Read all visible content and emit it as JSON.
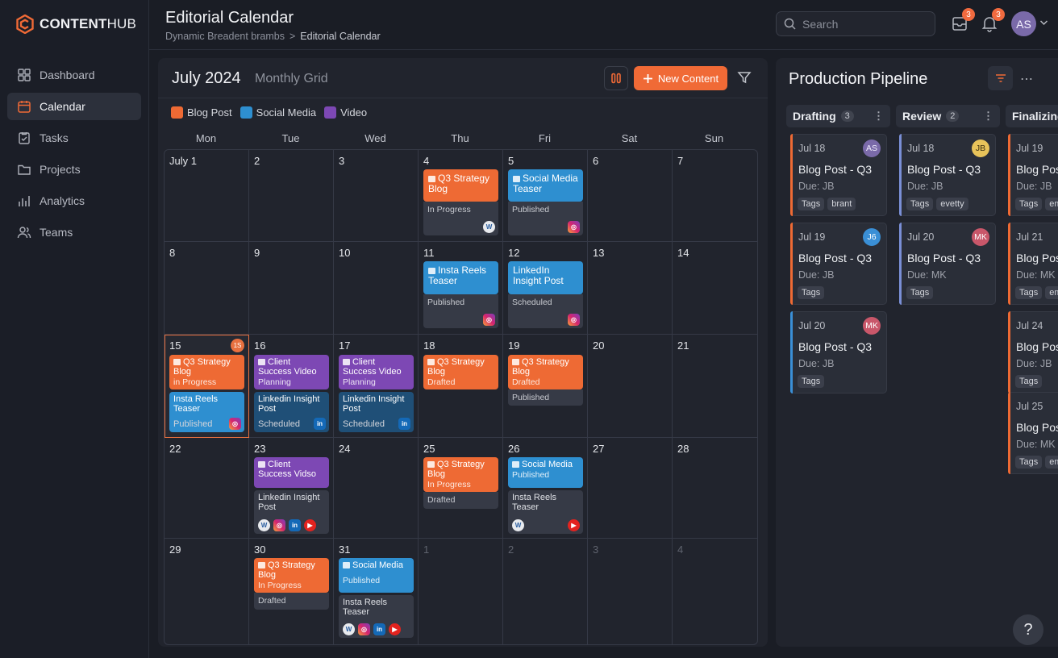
{
  "brand": {
    "bold": "CONTENT",
    "regular": "HUB",
    "accent": "#f06a36"
  },
  "sidebar": {
    "items": [
      {
        "label": "Dashboard",
        "icon": "dashboard-icon"
      },
      {
        "label": "Calendar",
        "icon": "calendar-icon",
        "active": true
      },
      {
        "label": "Tasks",
        "icon": "tasks-icon"
      },
      {
        "label": "Projects",
        "icon": "folder-icon"
      },
      {
        "label": "Analytics",
        "icon": "analytics-icon"
      },
      {
        "label": "Teams",
        "icon": "teams-icon"
      }
    ]
  },
  "header": {
    "title": "Editorial Calendar",
    "breadcrumb_parent": "Dynamic Breadent brambs",
    "breadcrumb_separator": ">",
    "breadcrumb_current": "Editorial Calendar",
    "search_placeholder": "Search",
    "inbox_badge": "3",
    "notif_badge": "3",
    "avatar": "AS"
  },
  "calendar": {
    "month": "July 2024",
    "view": "Monthly Grid",
    "new_button": "New Content",
    "legend": [
      {
        "label": "Blog Post",
        "color": "#ee6a34"
      },
      {
        "label": "Social Media",
        "color": "#2e8fd0"
      },
      {
        "label": "Video",
        "color": "#7d48b4"
      }
    ],
    "days": [
      "Mon",
      "Tue",
      "Wed",
      "Thu",
      "Fri",
      "Sat",
      "Sun"
    ],
    "weeks": [
      [
        "July 1",
        "2",
        "3",
        "4",
        "5",
        "6",
        "7"
      ],
      [
        "8",
        "9",
        "10",
        "11",
        "12",
        "13",
        "14"
      ],
      [
        "15",
        "16",
        "17",
        "18",
        "19",
        "20",
        "21"
      ],
      [
        "22",
        "23",
        "24",
        "25",
        "26",
        "27",
        "28"
      ],
      [
        "29",
        "30",
        "31",
        "1",
        "2",
        "3",
        "4"
      ]
    ],
    "today_badge": "1S",
    "events": {
      "jul4_title": "Q3 Strategy Blog",
      "jul4_status": "In Progress",
      "jul5_title": "Social Media Teaser",
      "jul5_status": "Published",
      "jul11_title": "Insta Reels Teaser",
      "jul11_status": "Published",
      "jul12_title": "LinkedIn Insight Post",
      "jul12_status": "Scheduled",
      "jul15a_title": "Q3 Strategy Blog",
      "jul15a_status": "in Progress",
      "jul15b_title": "Insta Reels Teaser",
      "jul15b_status": "Published",
      "jul16a_title": "Client Success Video",
      "jul16a_status": "Planning",
      "jul16b_title": "Linkedin Insight Post",
      "jul16b_status": "Scheduled",
      "jul17a_title": "Client Success Video",
      "jul17a_status": "Planning",
      "jul17b_title": "Linkedin Insight Post",
      "jul17b_status": "Scheduled",
      "jul18_title": "Q3 Strategy Blog",
      "jul18_status": "Drafted",
      "jul19_title": "Q3 Strategy Blog",
      "jul19_status": "Drafted",
      "jul19_status2": "Published",
      "jul23a_title": "Client Success Vidso",
      "jul23b_title": "Linkedin Insight Post",
      "jul25_title": "Q3 Strategy Blog",
      "jul25_status": "In Progress",
      "jul25_status2": "Drafted",
      "jul26a_title": "Social Media",
      "jul26a_status": "Published",
      "jul26b_title": "Insta Reels Teaser",
      "jul30_title": "Q3 Strategy Blog",
      "jul30_status": "In Progress",
      "jul30_status2": "Drafted",
      "jul31a_title": "Social Media",
      "jul31a_status": "Published",
      "jul31b_title": "Insta Reels Teaser"
    }
  },
  "pipeline": {
    "title": "Production Pipeline",
    "columns": [
      {
        "name": "Drafting",
        "count": "3",
        "cards": [
          {
            "date": "Jul 18",
            "title": "Blog Post - Q3",
            "due": "Due: JB",
            "tags": [
              "Tags",
              "brant"
            ],
            "avatar": "AS",
            "avatar_color": "#7a6aa9",
            "bar": "#ee6a34"
          },
          {
            "date": "Jul 19",
            "title": "Blog Post - Q3",
            "due": "Due: JB",
            "tags": [
              "Tags"
            ],
            "avatar": "J6",
            "avatar_color": "#3a8fd6",
            "bar": "#ee6a34"
          },
          {
            "date": "Jul 20",
            "title": "Blog Post - Q3",
            "due": "Due: JB",
            "tags": [
              "Tags"
            ],
            "avatar": "MK",
            "avatar_color": "#c9576a",
            "bar": "#3a8fd6"
          }
        ]
      },
      {
        "name": "Review",
        "count": "2",
        "cards": [
          {
            "date": "Jul 18",
            "title": "Blog Post - Q3",
            "due": "Due: JB",
            "tags": [
              "Tags",
              "evetty"
            ],
            "avatar": "JB",
            "avatar_color": "#e8c35a",
            "bar": "#7a8fd6"
          },
          {
            "date": "Jul 20",
            "title": "Blog Post - Q3",
            "due": "Due: MK",
            "tags": [
              "Tags"
            ],
            "avatar": "MK",
            "avatar_color": "#c9576a",
            "bar": "#7a8fd6"
          }
        ]
      },
      {
        "name": "Finalizing",
        "count": "",
        "cards": [
          {
            "date": "Jul 19",
            "title": "Blog Pos",
            "due": "Due: JB",
            "tags": [
              "Tags",
              "em"
            ],
            "bar": "#ee6a34"
          },
          {
            "date": "Jul 21",
            "title": "Blog Pos",
            "due": "Due: MK",
            "tags": [
              "Tags",
              "em"
            ],
            "bar": "#ee6a34"
          },
          {
            "date": "Jul 24",
            "title": "Blog Pos",
            "due": "Due: JB",
            "tags": [
              "Tags"
            ],
            "bar": "#ee6a34"
          },
          {
            "date": "Jul 25",
            "title": "Blog Pos",
            "due": "Due: MK",
            "tags": [
              "Tags",
              "em"
            ],
            "bar": "#ee6a34"
          }
        ]
      }
    ]
  },
  "help": "?"
}
